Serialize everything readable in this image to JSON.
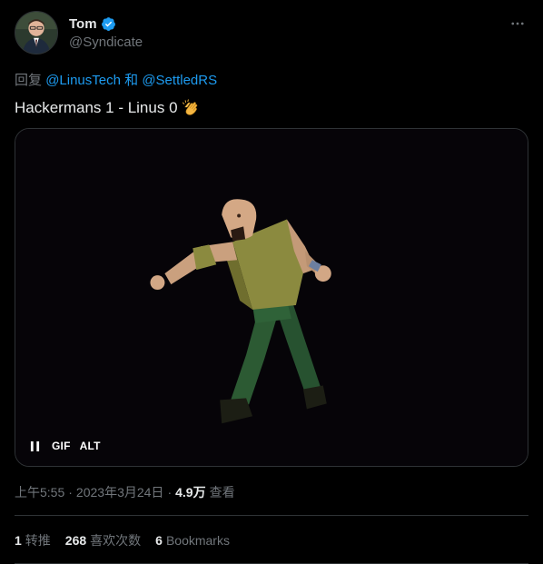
{
  "author": {
    "display_name": "Tom",
    "handle": "@Syndicate",
    "avatar_icon": "profile-avatar",
    "verified_icon": "verified-badge-icon",
    "verified_color": "#1d9bf0"
  },
  "more_icon": "more-dots-icon",
  "reply": {
    "prefix": "回复",
    "mention_1": "@LinusTech",
    "joiner": "和",
    "mention_2": "@SettledRS"
  },
  "tweet": {
    "text": "Hackermans 1 -  Linus 0",
    "emoji_icon": "clapping-hands-icon"
  },
  "media": {
    "type": "gif",
    "pause_icon": "pause-icon",
    "gif_label": "GIF",
    "alt_label": "ALT"
  },
  "meta": {
    "time": "上午5:55",
    "dot_1": "·",
    "date": "2023年3月24日",
    "dot_2": "·",
    "views_count": "4.9万",
    "views_label": "查看"
  },
  "stats": {
    "retweets_count": "1",
    "retweets_label": "转推",
    "likes_count": "268",
    "likes_label": "喜欢次数",
    "bookmarks_count": "6",
    "bookmarks_label": "Bookmarks"
  },
  "colors": {
    "background": "#000000",
    "text_primary": "#e7e9ea",
    "text_secondary": "#71767b",
    "link": "#1d9bf0",
    "border": "#2f3336"
  }
}
